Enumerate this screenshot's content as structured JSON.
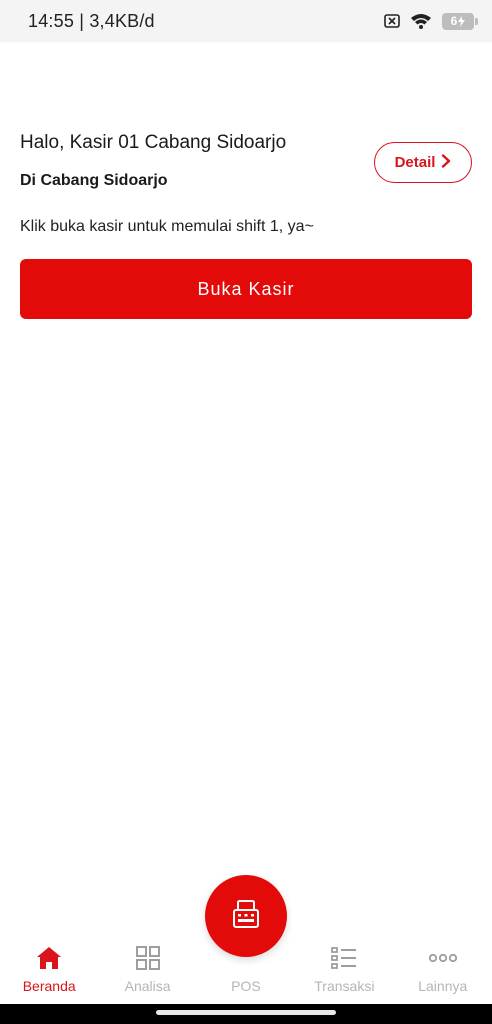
{
  "status_bar": {
    "time_speed": "14:55 | 3,4KB/d",
    "battery": "6",
    "icons": [
      "sim-off-icon",
      "wifi-icon",
      "battery-charging-icon"
    ]
  },
  "greeting": {
    "hello": "Halo, Kasir 01 Cabang Sidoarjo",
    "branch": "Di Cabang Sidoarjo",
    "detail_label": "Detail",
    "hint": "Klik buka kasir untuk memulai shift 1, ya~"
  },
  "actions": {
    "open_cashier": "Buka Kasir"
  },
  "bottom_nav": {
    "items": [
      {
        "label": "Beranda",
        "icon": "home-icon",
        "active": true
      },
      {
        "label": "Analisa",
        "icon": "grid-icon",
        "active": false
      },
      {
        "label": "POS",
        "icon": "cash-register-icon",
        "active": false
      },
      {
        "label": "Transaksi",
        "icon": "list-icon",
        "active": false
      },
      {
        "label": "Lainnya",
        "icon": "more-dots-icon",
        "active": false
      }
    ]
  },
  "colors": {
    "primary": "#e30a0a",
    "inactive": "#b5b5b5"
  }
}
